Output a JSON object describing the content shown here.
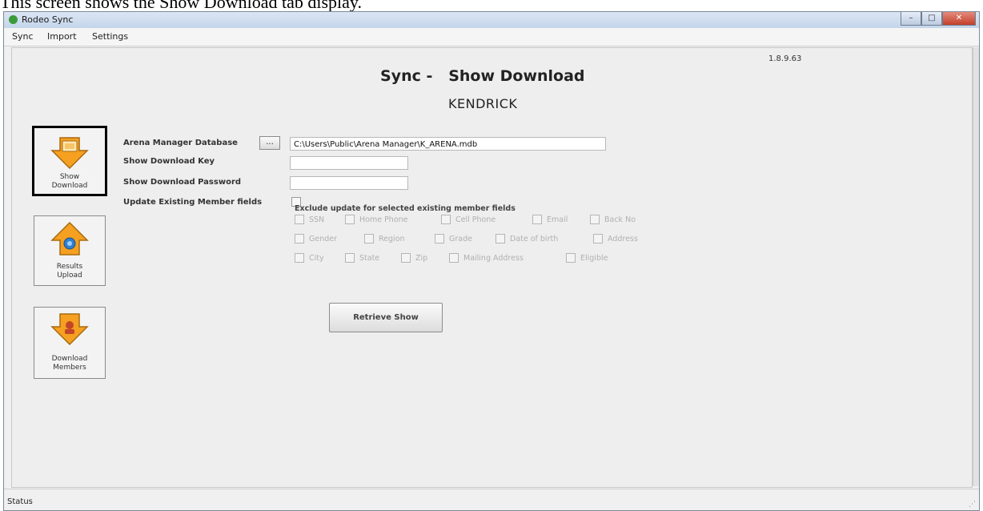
{
  "caption": "This screen shows the Show Download tab display.",
  "window": {
    "title": "Rodeo Sync",
    "controls": [
      "minimize",
      "maximize",
      "close"
    ]
  },
  "menu": [
    "Sync",
    "Import",
    "Settings"
  ],
  "version": "1.8.9.63",
  "heading": "Sync -   Show Download",
  "subheading": "KENDRICK",
  "nav": [
    {
      "label": "Show Download",
      "icon": "monitor-download-icon",
      "active": true
    },
    {
      "label": "Results Upload",
      "icon": "upload-arrow-icon",
      "active": false
    },
    {
      "label": "Download Members",
      "icon": "members-download-icon",
      "active": false
    }
  ],
  "form": {
    "db_label": "Arena Manager Database",
    "browse_label": "...",
    "db_value": "C:\\Users\\Public\\Arena Manager\\K_ARENA.mdb",
    "key_label": "Show Download Key",
    "key_value": "",
    "password_label": "Show Download Password",
    "password_value": "",
    "update_label": "Update Existing Member fields",
    "update_checked": false
  },
  "exclude": {
    "title": "Exclude update for selected existing member fields",
    "rows": [
      [
        "SSN",
        "Home Phone",
        "Cell Phone",
        "Email",
        "Back No"
      ],
      [
        "Gender",
        "Region",
        "Grade",
        "Date of birth",
        "Address"
      ],
      [
        "City",
        "State",
        "Zip",
        "Mailing Address",
        "Eligible"
      ]
    ]
  },
  "retrieve_label": "Retrieve Show",
  "status": "Status",
  "colors": {
    "icon_orange": "#f5a020",
    "active_border": "#000000",
    "titlebar": "#c4d5ea"
  }
}
